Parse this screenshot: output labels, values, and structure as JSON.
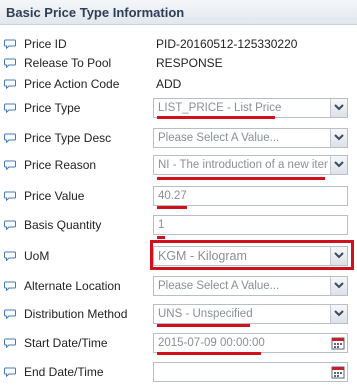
{
  "section": {
    "title": "Basic Price Type Information"
  },
  "fields": [
    {
      "label": "Price ID",
      "value": "PID-20160512-125330220"
    },
    {
      "label": "Release To Pool",
      "value": "RESPONSE"
    },
    {
      "label": "Price Action Code",
      "value": "ADD"
    },
    {
      "label": "Price Type",
      "value": "LIST_PRICE - List Price"
    },
    {
      "label": "Price Type Desc",
      "value": "Please Select A Value..."
    },
    {
      "label": "Price Reason",
      "value": "NI - The introduction of a new item"
    },
    {
      "label": "Price Value",
      "value": "40.27"
    },
    {
      "label": "Basis Quantity",
      "value": "1"
    },
    {
      "label": "UoM",
      "value": "KGM - Kilogram"
    },
    {
      "label": "Alternate Location",
      "value": "Please Select A Value..."
    },
    {
      "label": "Distribution Method",
      "value": "UNS - Unspecified"
    },
    {
      "label": "Start Date/Time",
      "value": "2015-07-09 00:00:00"
    },
    {
      "label": "End Date/Time",
      "value": ""
    }
  ],
  "icons": {
    "row_icon": "speech-bubble-icon",
    "dropdown_icon": "chevron-down-icon",
    "calendar_icon": "calendar-icon"
  },
  "colors": {
    "highlight": "#d0111b",
    "header_text": "#2d3e55",
    "bubble": "#3f79b8"
  }
}
